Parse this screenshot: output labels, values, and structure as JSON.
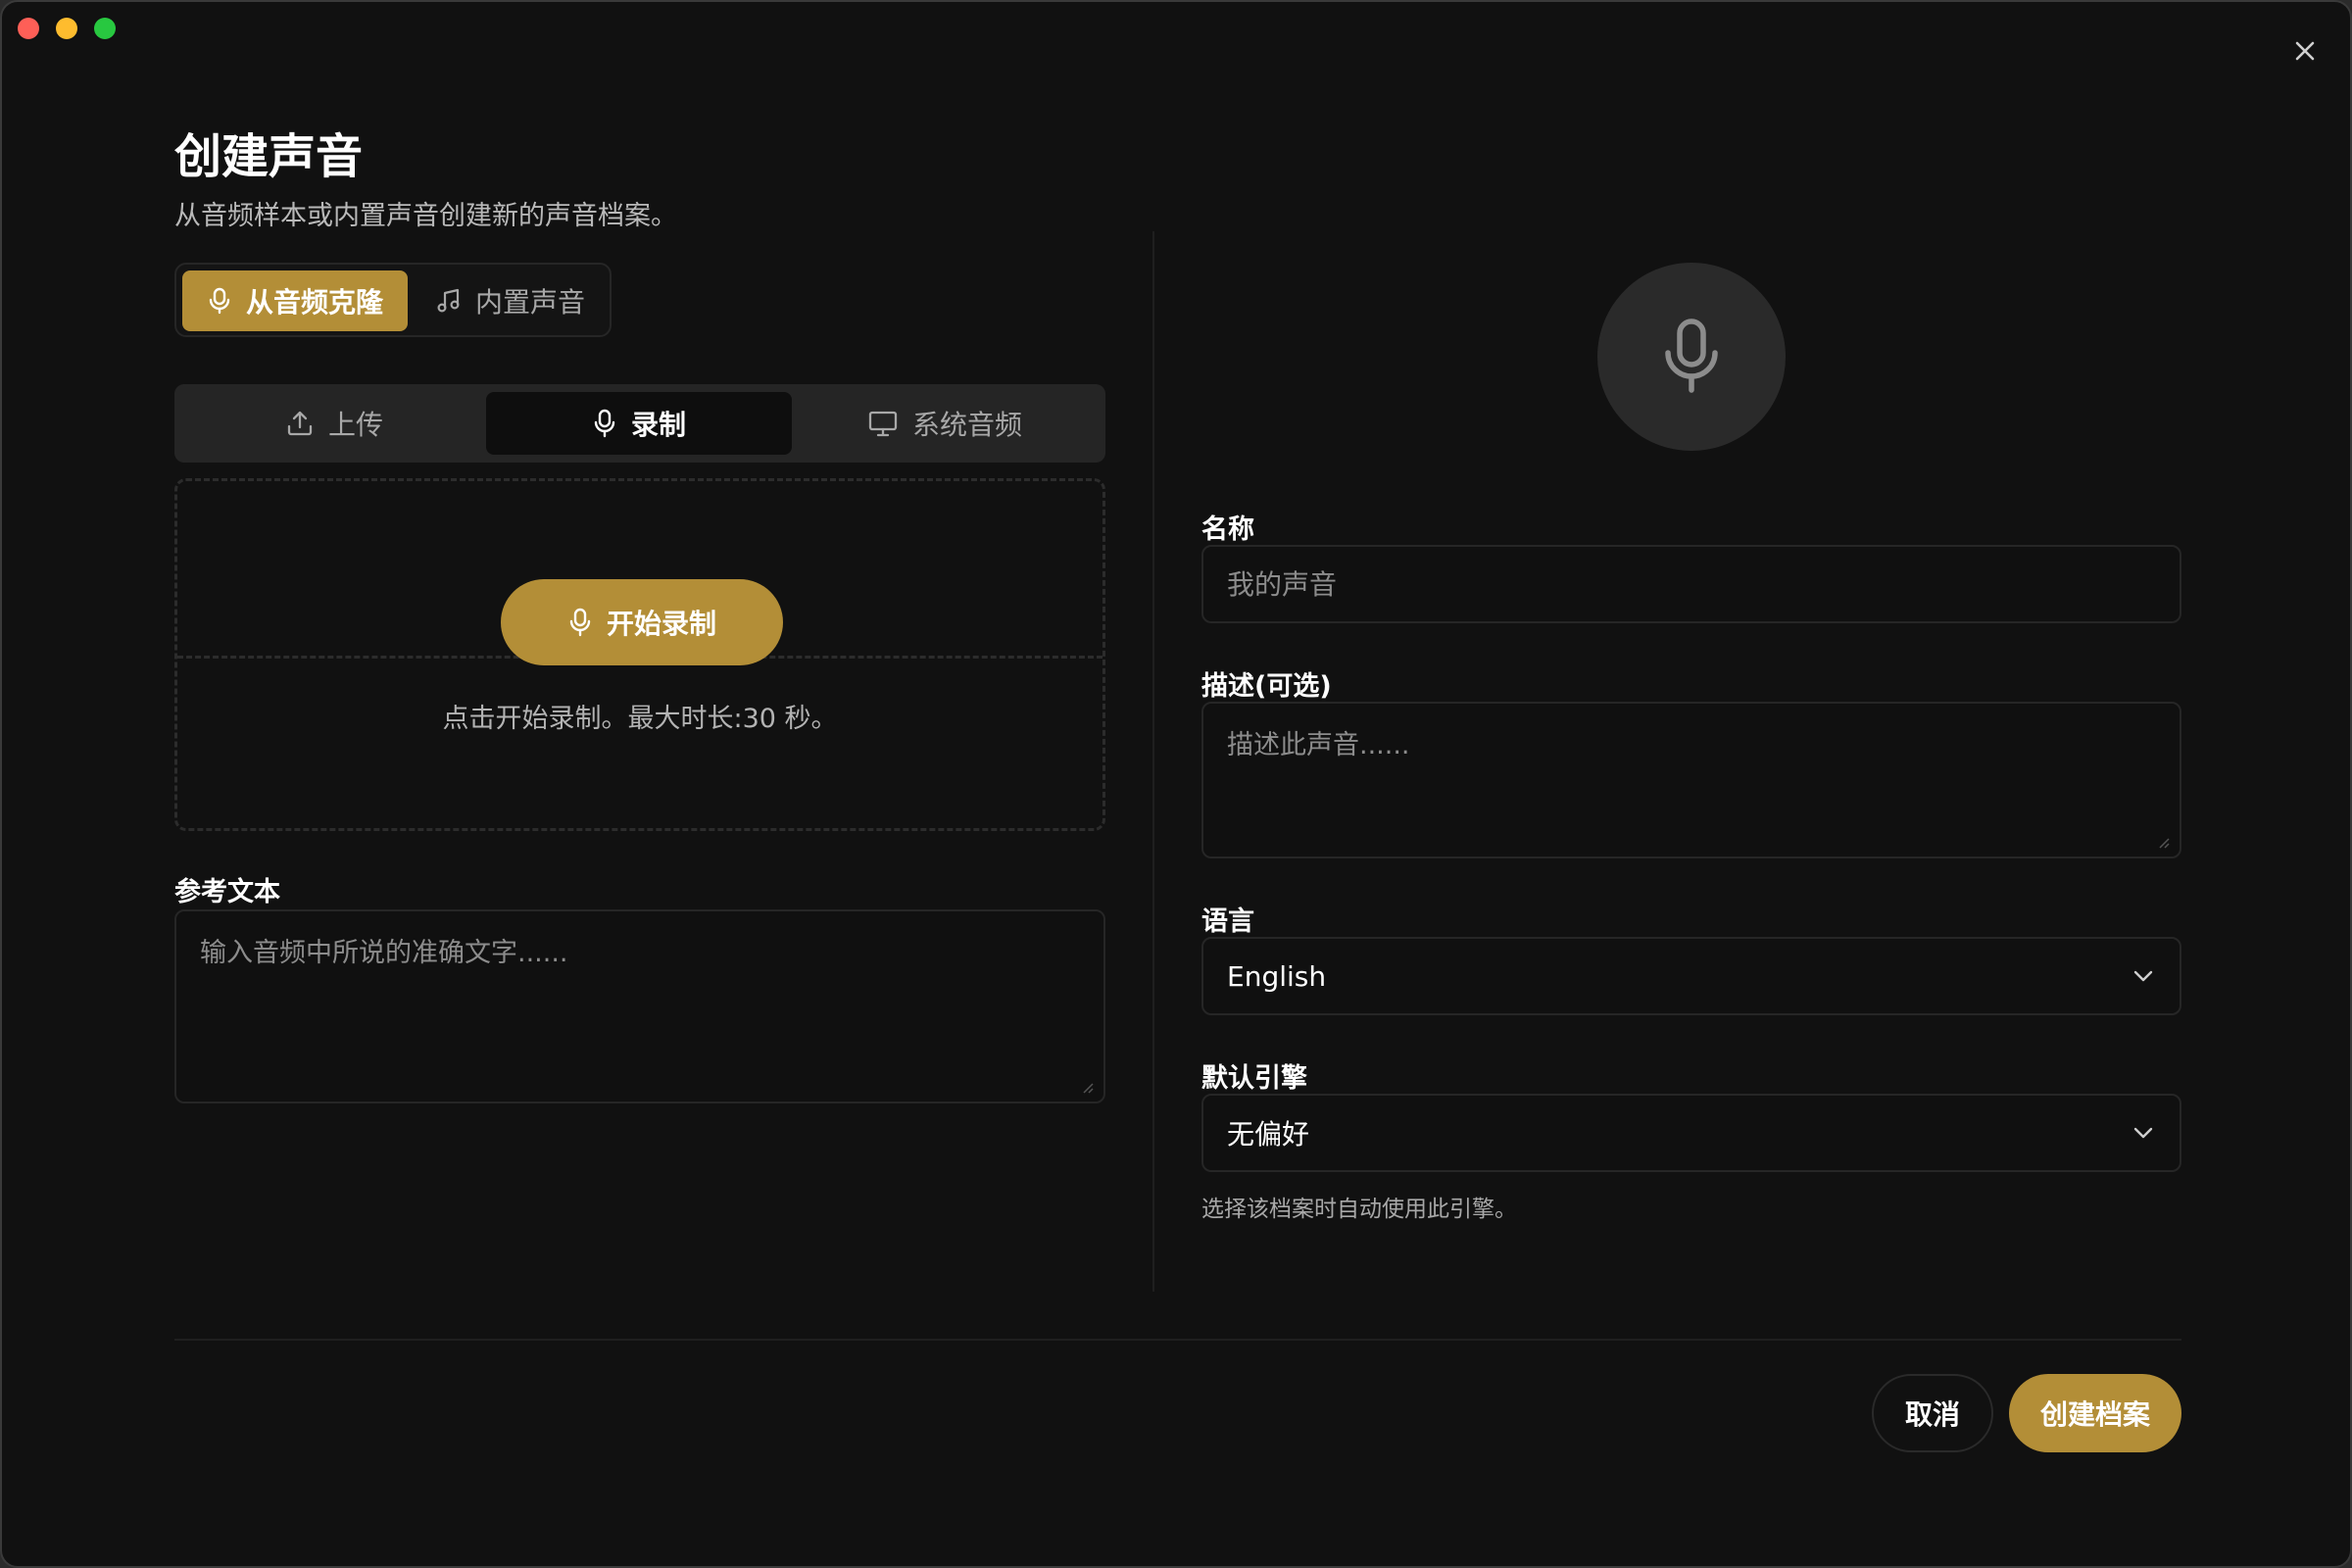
{
  "dialog": {
    "title": "创建声音",
    "subtitle": "从音频样本或内置声音创建新的声音档案。"
  },
  "mode_toggle": {
    "options": [
      {
        "label": "从音频克隆",
        "icon": "mic-icon",
        "selected": true
      },
      {
        "label": "内置声音",
        "icon": "music-note-icon",
        "selected": false
      }
    ]
  },
  "source_tabs": [
    {
      "label": "上传",
      "icon": "upload-icon",
      "selected": false
    },
    {
      "label": "录制",
      "icon": "mic-icon",
      "selected": true
    },
    {
      "label": "系统音频",
      "icon": "monitor-icon",
      "selected": false
    }
  ],
  "recorder": {
    "start_label": "开始录制",
    "hint": "点击开始录制。最大时长:30 秒。"
  },
  "reference_text": {
    "label": "参考文本",
    "placeholder": "输入音频中所说的准确文字......"
  },
  "profile": {
    "avatar_icon": "mic-icon",
    "name": {
      "label": "名称",
      "placeholder": "我的声音",
      "value": ""
    },
    "description": {
      "label": "描述(可选)",
      "placeholder": "描述此声音......",
      "value": ""
    },
    "language": {
      "label": "语言",
      "value": "English"
    },
    "engine": {
      "label": "默认引擎",
      "value": "无偏好",
      "helper": "选择该档案时自动使用此引擎。"
    }
  },
  "footer": {
    "cancel_label": "取消",
    "create_label": "创建档案"
  },
  "colors": {
    "accent": "#b38e37",
    "background": "#111111",
    "field_border": "#262626"
  }
}
